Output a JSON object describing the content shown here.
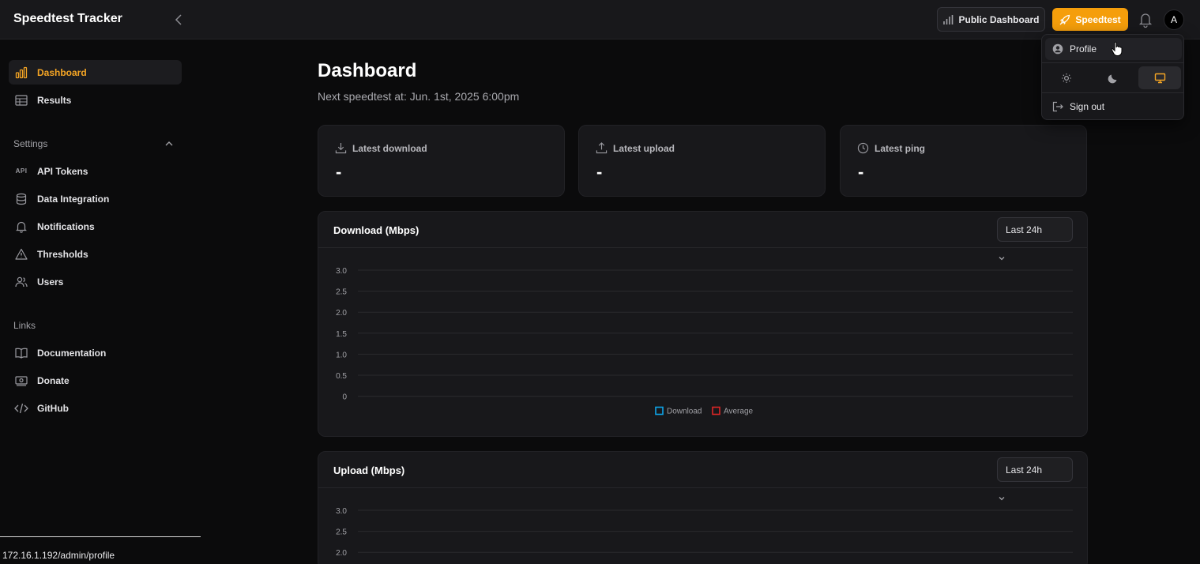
{
  "app": {
    "brand": "Speedtest Tracker"
  },
  "header": {
    "public_dashboard_label": "Public Dashboard",
    "speedtest_label": "Speedtest",
    "avatar_initial": "A"
  },
  "sidebar": {
    "items": [
      {
        "label": "Dashboard",
        "icon": "bar-chart-icon",
        "active": true
      },
      {
        "label": "Results",
        "icon": "table-icon",
        "active": false
      }
    ],
    "settings_label": "Settings",
    "settings_items": [
      {
        "label": "API Tokens",
        "icon": "api-icon",
        "icon_text": "API"
      },
      {
        "label": "Data Integration",
        "icon": "database-icon"
      },
      {
        "label": "Notifications",
        "icon": "bell-icon"
      },
      {
        "label": "Thresholds",
        "icon": "warning-icon"
      },
      {
        "label": "Users",
        "icon": "users-icon"
      }
    ],
    "links_label": "Links",
    "links_items": [
      {
        "label": "Documentation",
        "icon": "book-icon"
      },
      {
        "label": "Donate",
        "icon": "money-icon"
      },
      {
        "label": "GitHub",
        "icon": "code-icon"
      }
    ]
  },
  "main": {
    "title": "Dashboard",
    "subtitle": "Next speedtest at: Jun. 1st, 2025 6:00pm",
    "stats": [
      {
        "label": "Latest download",
        "value": "-",
        "icon": "download-icon"
      },
      {
        "label": "Latest upload",
        "value": "-",
        "icon": "upload-icon"
      },
      {
        "label": "Latest ping",
        "value": "-",
        "icon": "clock-icon"
      }
    ]
  },
  "charts": {
    "download": {
      "title": "Download (Mbps)",
      "range": "Last 24h"
    },
    "upload": {
      "title": "Upload (Mbps)",
      "range": "Last 24h"
    }
  },
  "chart_data": [
    {
      "type": "line",
      "title": "Download (Mbps)",
      "xlabel": "",
      "ylabel": "",
      "ylim": [
        0,
        3.0
      ],
      "yticks": [
        "3.0",
        "2.5",
        "2.0",
        "1.5",
        "1.0",
        "0.5",
        "0"
      ],
      "x": [],
      "series": [
        {
          "name": "Download",
          "values": [],
          "color": "#0ea5e9"
        },
        {
          "name": "Average",
          "values": [],
          "color": "#dc2626"
        }
      ],
      "legend": "bottom-center",
      "grid": true
    },
    {
      "type": "line",
      "title": "Upload (Mbps)",
      "xlabel": "",
      "ylabel": "",
      "ylim": [
        0,
        3.0
      ],
      "yticks": [
        "3.0",
        "2.5",
        "2.0"
      ],
      "x": [],
      "series": [],
      "grid": true
    }
  ],
  "dropdown": {
    "profile_label": "Profile",
    "themes": [
      "light",
      "dark",
      "system"
    ],
    "active_theme": "system",
    "signout_label": "Sign out"
  },
  "statusbar": {
    "url": "172.16.1.192/admin/profile"
  },
  "colors": {
    "accent": "#f59e0b",
    "download": "#0ea5e9",
    "average": "#dc2626"
  }
}
